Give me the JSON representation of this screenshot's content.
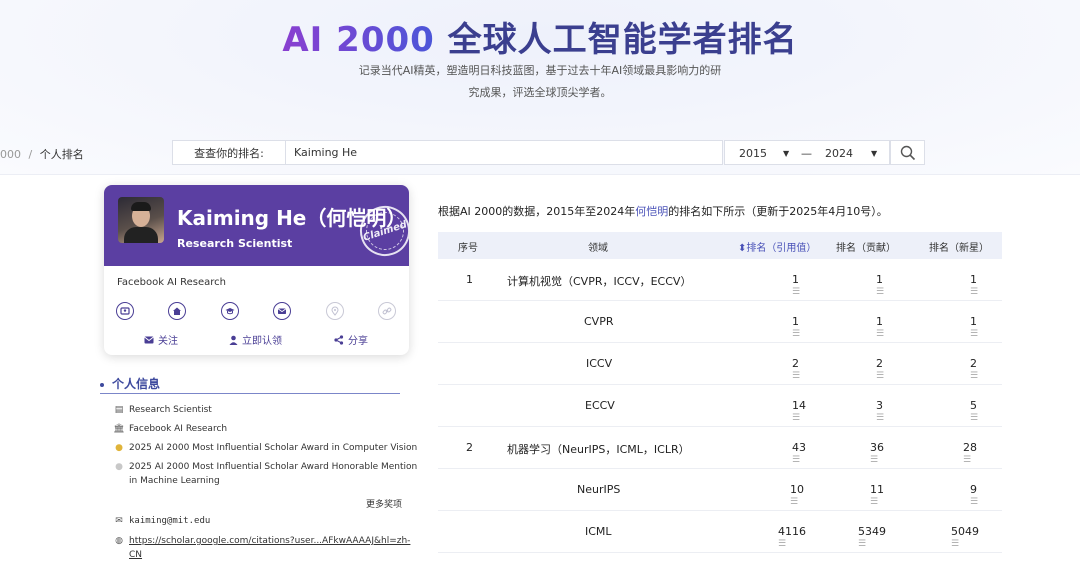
{
  "hero": {
    "title_accent": "AI 2000",
    "title_rest": " 全球人工智能学者排名",
    "desc_line1": "记录当代AI精英，塑造明日科技蓝图，基于过去十年AI领域最具影响力的研",
    "desc_line2": "究成果，评选全球顶尖学者。"
  },
  "breadcrumb": {
    "prev": "000",
    "sep": "/",
    "current": "个人排名"
  },
  "search": {
    "label": "查查你的排名:",
    "value": "Kaiming He",
    "year_from": "2015",
    "year_sep": "—",
    "year_to": "2024"
  },
  "profile": {
    "name": "Kaiming He（何恺明）",
    "role": "Research Scientist",
    "stamp": "Claimed",
    "org": "Facebook AI Research",
    "icons": [
      "id-icon",
      "home-icon",
      "education-icon",
      "email-icon",
      "location-icon",
      "link-icon"
    ],
    "actions": {
      "follow": "关注",
      "claim": "立即认领",
      "share": "分享"
    }
  },
  "info": {
    "title": "个人信息",
    "position": "Research Scientist",
    "institution": "Facebook AI Research",
    "award1": "2025 AI 2000 Most Influential Scholar Award in Computer Vision",
    "award2_line1": "2025 AI 2000 Most Influential Scholar Award Honorable Mention",
    "award2_line2": "in Machine Learning",
    "more_awards": "更多奖项",
    "email": "kaiming@mit.edu",
    "scholar_line1": "https://scholar.google.com/citations?user...AFkwAAAAJ&hl=zh-",
    "scholar_line2": "CN"
  },
  "table": {
    "desc_pre": "根据AI 2000的数据，2015年至2024年",
    "desc_name": "何恺明",
    "desc_post": "的排名如下所示（更新于2025年4月10号）。",
    "headers": {
      "index": "序号",
      "field": "领域",
      "rank_cite": "排名（引用值）",
      "rank_contrib": "排名（贡献）",
      "rank_rising": "排名（新星）"
    },
    "rows": [
      {
        "index": "1",
        "field": "计算机视觉（CVPR，ICCV，ECCV）",
        "cite": "1",
        "contrib": "1",
        "rising": "1"
      },
      {
        "index": "",
        "field": "CVPR",
        "cite": "1",
        "contrib": "1",
        "rising": "1"
      },
      {
        "index": "",
        "field": "ICCV",
        "cite": "2",
        "contrib": "2",
        "rising": "2"
      },
      {
        "index": "",
        "field": "ECCV",
        "cite": "14",
        "contrib": "3",
        "rising": "5"
      },
      {
        "index": "2",
        "field": "机器学习（NeurIPS，ICML，ICLR）",
        "cite": "43",
        "contrib": "36",
        "rising": "28"
      },
      {
        "index": "",
        "field": "NeurIPS",
        "cite": "10",
        "contrib": "11",
        "rising": "9"
      },
      {
        "index": "",
        "field": "ICML",
        "cite": "4116",
        "contrib": "5349",
        "rising": "5049"
      }
    ]
  },
  "colors": {
    "brand_purple": "#5b3fa2",
    "accent_blue": "#4a52b8"
  }
}
